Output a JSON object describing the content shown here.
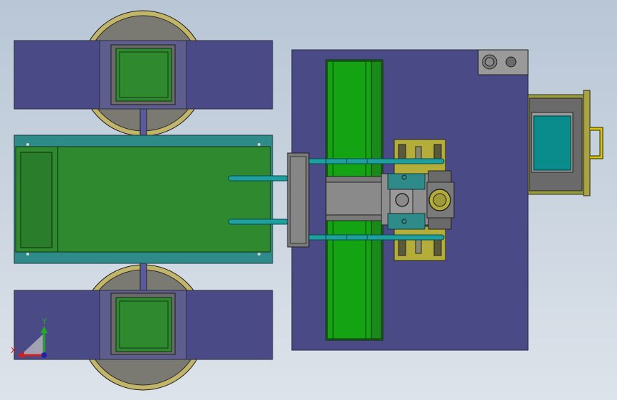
{
  "viewport": {
    "background_top": "#b8c6d6",
    "background_bottom": "#dde3ea"
  },
  "colors": {
    "plate": "#4a4a86",
    "plate_edge": "#2a2a40",
    "green": "#2f8a2f",
    "green_dark": "#1e6a1e",
    "green_bright": "#13a313",
    "teal": "#2f8a8a",
    "cyan": "#0a8c8c",
    "rod": "#1fa0a0",
    "khaki": "#b4ad3a",
    "gray": "#808080",
    "wheel_rim": "#c2b56a",
    "wheel_face": "#7a7a72",
    "handle": "#d8c400"
  },
  "triad": {
    "y_label": "Y",
    "x_label": "X",
    "y_color": "#22aa22",
    "x_color": "#cc2222",
    "origin_color": "#2222aa"
  }
}
